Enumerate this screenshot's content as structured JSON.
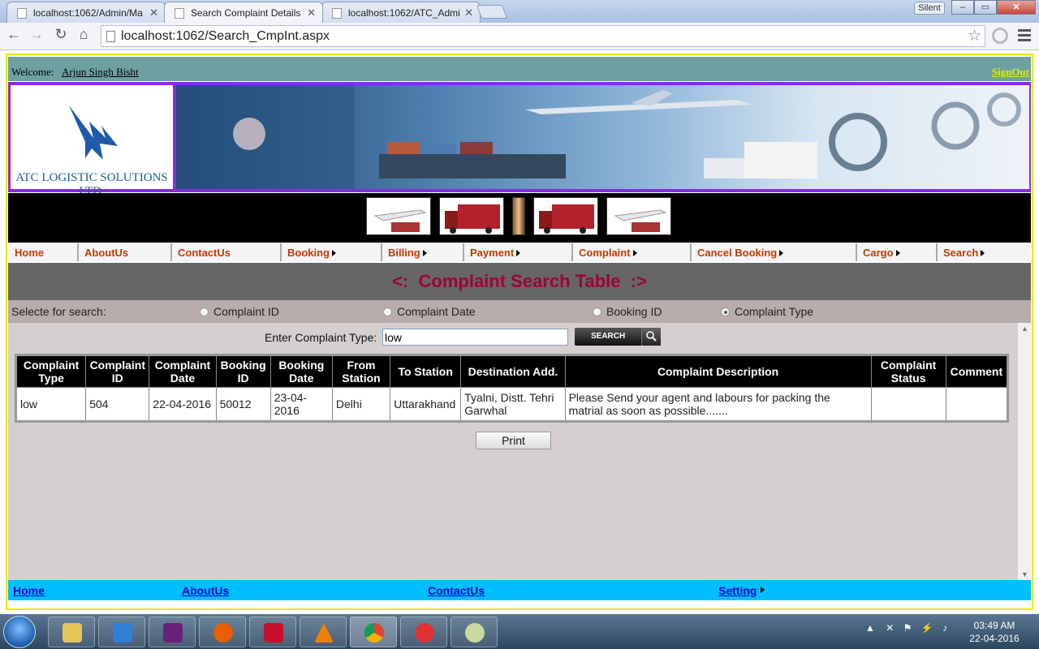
{
  "browser": {
    "tabs": [
      {
        "title": "localhost:1062/Admin/Ma"
      },
      {
        "title": "Search Complaint Details"
      },
      {
        "title": "localhost:1062/ATC_Admi"
      }
    ],
    "profile": "Silent",
    "url": "localhost:1062/Search_CmpInt.aspx"
  },
  "header": {
    "welcome_label": "Welcome:",
    "user_name": "Arjun Singh Bisht",
    "signout": "SignOut",
    "logo_text": "ATC LOGISTIC SOLUTIONS LTD."
  },
  "nav": {
    "items": [
      {
        "label": "Home",
        "submenu": false
      },
      {
        "label": "AboutUs",
        "submenu": false
      },
      {
        "label": "ContactUs",
        "submenu": false
      },
      {
        "label": "Booking",
        "submenu": true
      },
      {
        "label": "Billing",
        "submenu": true
      },
      {
        "label": "Payment",
        "submenu": true
      },
      {
        "label": "Complaint",
        "submenu": true
      },
      {
        "label": "Cancel Booking",
        "submenu": true
      },
      {
        "label": "Cargo",
        "submenu": true
      },
      {
        "label": "Search",
        "submenu": true
      }
    ]
  },
  "page": {
    "title": "Complaint Search Table",
    "title_left_deco": "<:",
    "title_right_deco": ":>",
    "search_select_label": "Selecte for search:",
    "radio_options": [
      {
        "label": "Complaint ID",
        "selected": false
      },
      {
        "label": "Complaint Date",
        "selected": false
      },
      {
        "label": "Booking ID",
        "selected": false
      },
      {
        "label": "Complaint Type",
        "selected": true
      }
    ],
    "input_label": "Enter Complaint Type:",
    "input_value": "low",
    "search_button": "SEARCH",
    "print_button": "Print"
  },
  "table": {
    "headers": [
      "Complaint Type",
      "Complaint ID",
      "Complaint Date",
      "Booking ID",
      "Booking Date",
      "From Station",
      "To Station",
      "Destination Add.",
      "Complaint Description",
      "Complaint Status",
      "Comment"
    ],
    "rows": [
      [
        "low",
        "504",
        "22-04-2016",
        "50012",
        "23-04-2016",
        "Delhi",
        "Uttarakhand",
        "Tyalni, Distt. Tehri Garwhal",
        "Please Send your agent and labours for packing the matrial as soon as possible.......",
        "",
        ""
      ]
    ]
  },
  "footer": {
    "links": [
      {
        "label": "Home"
      },
      {
        "label": "AboutUs"
      },
      {
        "label": "ContactUs"
      },
      {
        "label": "Setting"
      }
    ]
  },
  "taskbar": {
    "time": "03:49 AM",
    "date": "22-04-2016"
  },
  "colors": {
    "nav_text": "#c23a00",
    "title_text": "#a0003a",
    "welcome_bar": "#6ea0a2",
    "footer_bar": "#00bfff",
    "banner_border": "#8a2be2"
  }
}
